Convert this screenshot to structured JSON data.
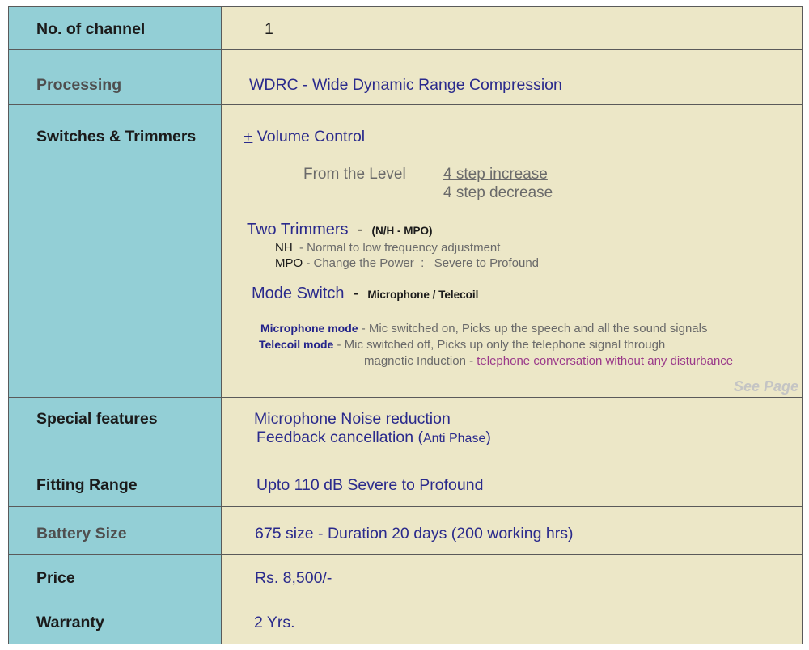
{
  "rows": {
    "channel": {
      "label": "No. of channel",
      "value": "1"
    },
    "processing": {
      "label": "Processing",
      "value": "WDRC - Wide Dynamic Range Compression"
    },
    "switches": {
      "label": "Switches & Trimmers",
      "volume": {
        "plus": "+",
        "text": " Volume Control"
      },
      "level": {
        "label": "From the Level",
        "increase": "4 step increase",
        "decrease": "4 step decrease"
      },
      "trimmers": {
        "title": "Two Trimmers",
        "dash": "  -  ",
        "spec": "(N/H  - MPO)",
        "nh_key": "NH",
        "nh_desc": "  - Normal to low frequency adjustment",
        "mpo_key": "MPO",
        "mpo_desc": " - Change the Power  :   Severe to Profound"
      },
      "mode": {
        "title": "Mode Switch",
        "dash": "  -  ",
        "spec": "Microphone / Telecoil",
        "mic_key": "Microphone mode",
        "mic_desc": " - Mic switched on, Picks up the speech and all the sound signals",
        "tel_key": "Telecoil mode",
        "tel_desc": " - Mic switched off, Picks up only the telephone signal through",
        "tel_line2_a": "magnetic Induction - ",
        "tel_line2_b": "telephone conversation without any disturbance"
      },
      "see_page": "See Page"
    },
    "special": {
      "label": "Special features",
      "line1": "Microphone Noise reduction",
      "line2_a": "Feedback cancellation (",
      "line2_b": "Anti Phase",
      "line2_c": ")"
    },
    "fitting": {
      "label": "Fitting Range",
      "value": "Upto 110 dB  Severe to Profound"
    },
    "battery": {
      "label": "Battery Size",
      "value": "675 size - Duration 20 days (200 working hrs)"
    },
    "price": {
      "label": "Price",
      "value": "Rs. 8,500/-"
    },
    "warranty": {
      "label": "Warranty",
      "value": "2 Yrs."
    }
  },
  "colors": {
    "label_bg": "#93cfd6",
    "value_bg": "#ece7c7",
    "value_text": "#2a2a8c",
    "highlight": "#9b3a8a",
    "border": "#5a5a5a"
  }
}
